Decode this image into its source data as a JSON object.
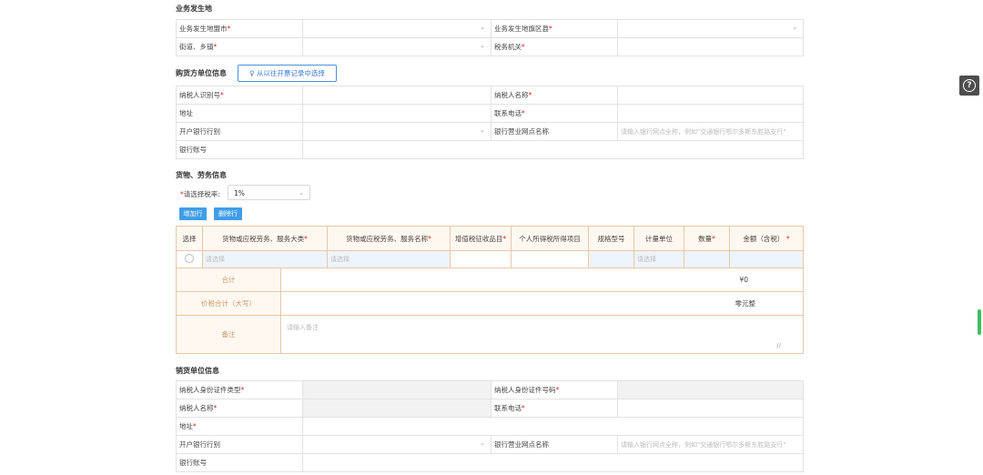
{
  "sections": {
    "location": "业务发生地",
    "buyer": "购货方单位信息",
    "goods": "货物、劳务信息",
    "seller": "销货单位信息"
  },
  "location": {
    "city_label": "业务发生地盟市",
    "county_label": "业务发生地旗区县",
    "street_label": "街道、乡镇",
    "tax_office_label": "税务机关"
  },
  "buyer": {
    "pick_button": "从以往开票记录中选择",
    "taxpayer_id_label": "纳税人识别号",
    "taxpayer_name_label": "纳税人名称",
    "address_label": "地址",
    "phone_label": "联系电话",
    "bank_label": "开户银行行别",
    "branch_label": "银行营业网点名称",
    "branch_placeholder": "请输入银行网点全称，例如\"交通银行鄂尔多斯东胜路支行\"",
    "account_label": "银行账号"
  },
  "goods": {
    "rate_label": "请选择税率:",
    "rate_value": "1%",
    "add_row": "增加行",
    "delete_row": "删除行",
    "columns": {
      "select": "选择",
      "category": "货物或应税劳务、服务大类",
      "name": "货物或应税劳务、服务名称",
      "vat_item": "增值税征收品目",
      "pit_item": "个人所得税所得项目",
      "spec": "规格型号",
      "unit": "计量单位",
      "qty": "数量",
      "amount": "金额（含税）"
    },
    "row_placeholder": "请选择",
    "total_label": "合计",
    "total_value": "¥0",
    "total_upper_label": "价税合计（大写）",
    "total_upper_value": "零元整",
    "remark_label": "备注",
    "remark_placeholder": "请输入备注"
  },
  "seller": {
    "id_type_label": "纳税人身份证件类型",
    "id_number_label": "纳税人身份证件号码",
    "name_label": "纳税人名称",
    "phone_label": "联系电话",
    "address_label": "地址",
    "bank_label": "开户银行行别",
    "branch_label": "银行营业网点名称",
    "branch_placeholder": "请输入银行网点全称，例如\"交通银行鄂尔多斯东胜路支行\"",
    "account_label": "银行账号"
  },
  "misc": {
    "required_mark": "*",
    "caret": "⌄",
    "help_icon": "?"
  },
  "colors": {
    "accent": "#3f9de8",
    "required": "#e02020",
    "table_header_bg": "#fff8f0",
    "table_border": "#e8c7a8"
  }
}
